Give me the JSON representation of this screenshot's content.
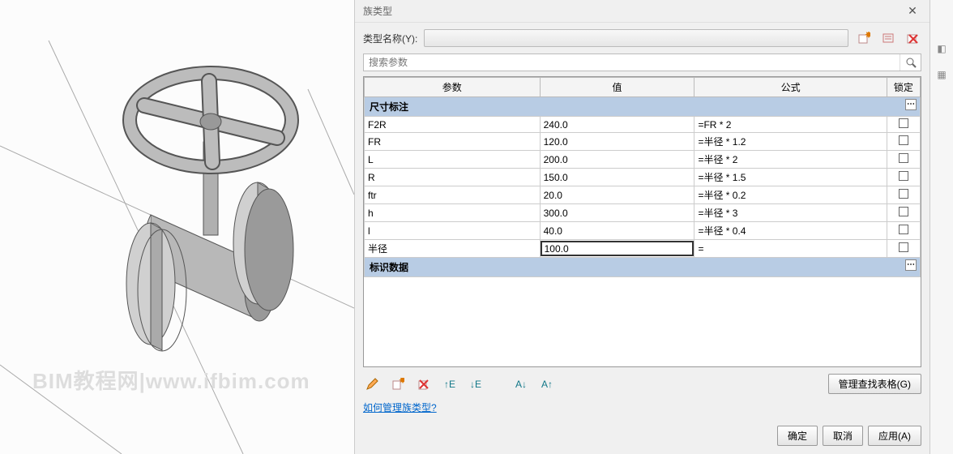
{
  "dialog": {
    "title": "族类型",
    "type_name_label": "类型名称(Y):",
    "search_placeholder": "搜索参数",
    "headers": {
      "param": "参数",
      "value": "值",
      "formula": "公式",
      "lock": "锁定"
    },
    "sections": {
      "dim": "尺寸标注",
      "identity": "标识数据"
    },
    "rows": [
      {
        "param": "F2R",
        "value": "240.0",
        "formula": "=FR * 2"
      },
      {
        "param": "FR",
        "value": "120.0",
        "formula": "=半径 * 1.2"
      },
      {
        "param": "L",
        "value": "200.0",
        "formula": "=半径 * 2"
      },
      {
        "param": "R",
        "value": "150.0",
        "formula": "=半径 * 1.5"
      },
      {
        "param": "ftr",
        "value": "20.0",
        "formula": "=半径 * 0.2"
      },
      {
        "param": "h",
        "value": "300.0",
        "formula": "=半径 * 3"
      },
      {
        "param": "l",
        "value": "40.0",
        "formula": "=半径 * 0.4"
      },
      {
        "param": "半径",
        "value": "100.0",
        "formula": "=",
        "editing": true
      }
    ],
    "manage_lookup": "管理查找表格(G)",
    "help_link": "如何管理族类型?",
    "buttons": {
      "ok": "确定",
      "cancel": "取消",
      "apply": "应用(A)"
    },
    "toolbar_icons": {
      "new_type": "new-type-icon",
      "rename": "rename-icon",
      "delete_type": "delete-type-icon",
      "pencil": "pencil-icon",
      "new_param": "new-param-icon",
      "delete_param": "delete-param-icon",
      "move_up": "move-up-icon",
      "move_down": "move-down-icon",
      "sort_asc": "sort-asc-icon",
      "sort_desc": "sort-desc-icon"
    }
  },
  "watermark": "BIM教程网|www.ifbim.com"
}
